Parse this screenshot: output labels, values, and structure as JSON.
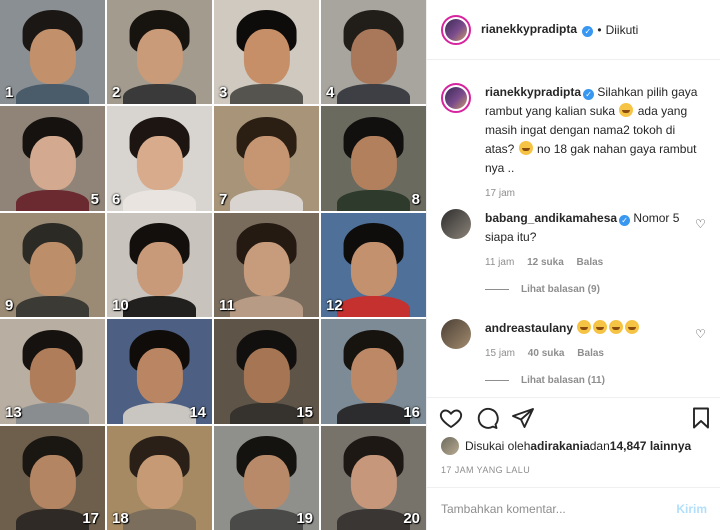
{
  "grid": {
    "cells": [
      {
        "n": "1",
        "bg": "#8a8f93",
        "hair": "#1a1714",
        "body": "#4a5b6a",
        "face": "#c2916c",
        "pos": "left"
      },
      {
        "n": "2",
        "bg": "#a39b8e",
        "hair": "#17130f",
        "body": "#3a3a3a",
        "face": "#c99b78",
        "pos": "left"
      },
      {
        "n": "3",
        "bg": "#cfc9bf",
        "hair": "#0e0c0a",
        "body": "#55544f",
        "face": "#c68f68",
        "pos": "left"
      },
      {
        "n": "4",
        "bg": "#a7a59e",
        "hair": "#211d19",
        "body": "#3d3f44",
        "face": "#a9785a",
        "pos": "left"
      },
      {
        "n": "5",
        "bg": "#8f8477",
        "hair": "#15120f",
        "body": "#6b2a2f",
        "face": "#d3aa90",
        "pos": "right"
      },
      {
        "n": "6",
        "bg": "#d8d4cf",
        "hair": "#1c1512",
        "body": "#e9e4df",
        "face": "#d7ab8c",
        "pos": "left"
      },
      {
        "n": "7",
        "bg": "#a79479",
        "hair": "#2b1f14",
        "body": "#d9d4d0",
        "face": "#c69572",
        "pos": "left"
      },
      {
        "n": "8",
        "bg": "#6a6a5e",
        "hair": "#12100e",
        "body": "#2e3a2c",
        "face": "#b3805e",
        "pos": "right"
      },
      {
        "n": "9",
        "bg": "#9b8b74",
        "hair": "#2b2a25",
        "body": "#3b3a34",
        "face": "#bd8e6a",
        "pos": "left"
      },
      {
        "n": "10",
        "bg": "#c8c3bd",
        "hair": "#120f0c",
        "body": "#22201e",
        "face": "#c99a79",
        "pos": "left"
      },
      {
        "n": "11",
        "bg": "#7a6c5d",
        "hair": "#241a12",
        "body": "#b89b85",
        "face": "#c79c7d",
        "pos": "left"
      },
      {
        "n": "12",
        "bg": "#4f7099",
        "hair": "#0f0d0c",
        "body": "#c4312e",
        "face": "#c4916e",
        "pos": "left"
      },
      {
        "n": "13",
        "bg": "#b8aea2",
        "hair": "#16120f",
        "body": "#8a8d8f",
        "face": "#b07d5b",
        "pos": "left"
      },
      {
        "n": "14",
        "bg": "#4d5f82",
        "hair": "#0f0c0a",
        "body": "#c9c5c1",
        "face": "#b98563",
        "pos": "right"
      },
      {
        "n": "15",
        "bg": "#5f5448",
        "hair": "#12100e",
        "body": "#36322d",
        "face": "#a67654",
        "pos": "right"
      },
      {
        "n": "16",
        "bg": "#7c8b95",
        "hair": "#17130f",
        "body": "#2c2c2e",
        "face": "#bd8866",
        "pos": "right"
      },
      {
        "n": "17",
        "bg": "#6e5f4c",
        "hair": "#1a1612",
        "body": "#2f2a25",
        "face": "#b48563",
        "pos": "right"
      },
      {
        "n": "18",
        "bg": "#a58a63",
        "hair": "#2a2018",
        "body": "#7b6e5c",
        "face": "#c69a74",
        "pos": "left"
      },
      {
        "n": "19",
        "bg": "#8f8f8c",
        "hair": "#15130f",
        "body": "#4a4a48",
        "face": "#b88a69",
        "pos": "right"
      },
      {
        "n": "20",
        "bg": "#77736b",
        "hair": "#1d1814",
        "body": "#3a3633",
        "face": "#c6977a",
        "pos": "right"
      }
    ]
  },
  "header": {
    "username": "rianekkypradipta",
    "separator": "•",
    "follow_state": "Diikuti",
    "verified_icon": "verified-badge-icon"
  },
  "caption": {
    "username": "rianekkypradipta",
    "text_1": " Silahkan pilih gaya rambut yang kalian suka ",
    "text_2": " ada yang masih ingat dengan nama2 tokoh di atas? ",
    "text_3": " no 18 gak nahan gaya rambut nya ..",
    "time": "17 jam"
  },
  "comments": [
    {
      "username": "babang_andikamahesa",
      "text": " Nomor 5 siapa itu?",
      "time": "11 jam",
      "likes": "12 suka",
      "reply": "Balas",
      "view_replies": "Lihat balasan (9)"
    },
    {
      "username": "andreastaulany",
      "text": "",
      "emoji_count": 4,
      "time": "15 jam",
      "likes": "40 suka",
      "reply": "Balas",
      "view_replies": "Lihat balasan (11)"
    }
  ],
  "liked_by": {
    "prefix": "Disukai oleh ",
    "user": "adirakania",
    "middle": " dan ",
    "count": "14,847 lainnya"
  },
  "posted_ago": "17 JAM YANG LALU",
  "add_comment": {
    "placeholder": "Tambahkan komentar...",
    "send_label": "Kirim"
  },
  "colors": {
    "accent": "#3897f0",
    "story_ring": "#d6249f",
    "muted": "#8e8e8e",
    "send_disabled": "#b2dffc"
  }
}
